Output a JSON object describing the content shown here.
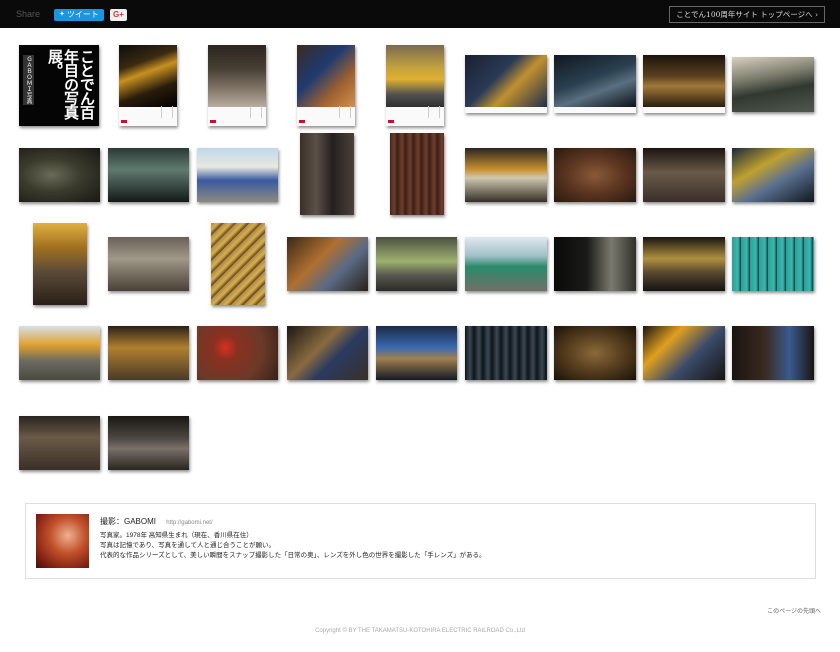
{
  "header": {
    "share_label": "Share",
    "tweet_label": "ツイート",
    "gplus_label": "G+",
    "top_link": "ことでん100周年サイト トップページへ ›"
  },
  "cover": {
    "title": "ことでん百年目の写真展。",
    "subtitle": "ＧＡＢＯＭＩ写真"
  },
  "profile": {
    "credit": "撮影：GABOMI",
    "url": "http://gabomi.net/",
    "bio_line1": "写真家。1978年 高知県生まれ（現在、香川県在住）",
    "bio_line2": "写真は記憶であり、写真を通して人と通じ合うことが願い。",
    "bio_line3": "代表的な作品シリーズとして、美しい瞬間をスナップ撮影した「日常の奥」、レンズを外し色の世界を撮影した「手レンズ」がある。"
  },
  "footer": {
    "page_top": "このページの先頭へ",
    "copyright": "Copyright © BY THE TAKAMATSU-KOTOHIRA ELECTRIC RAILROAD Co.,Ltd"
  },
  "colors": {
    "topbar": "#0a0a0a",
    "tweet": "#1b95e0",
    "accent_red": "#c8102e"
  }
}
